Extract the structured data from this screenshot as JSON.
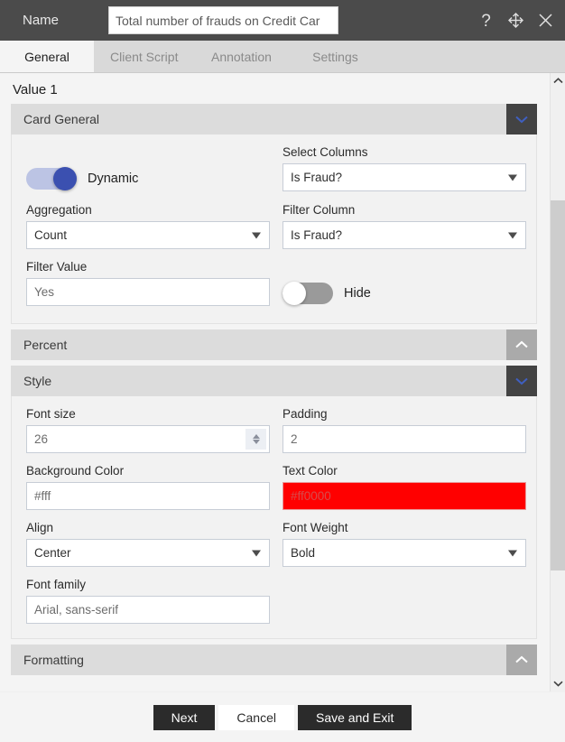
{
  "window": {
    "name_label": "Name",
    "name_value": "Total number of frauds on Credit Car",
    "name_placeholder": "Name",
    "icons": {
      "help": "help-question-icon",
      "move": "move-arrows-icon",
      "close": "close-x-icon"
    }
  },
  "tabs": [
    {
      "label": "General",
      "active": true
    },
    {
      "label": "Client Script",
      "active": false
    },
    {
      "label": "Annotation",
      "active": false
    },
    {
      "label": "Settings",
      "active": false
    }
  ],
  "value_section": {
    "title": "Value 1"
  },
  "sections": {
    "card_general": {
      "title": "Card General",
      "expanded": true,
      "fields": {
        "dynamic_toggle": {
          "label": "Dynamic",
          "state": "on"
        },
        "select_columns": {
          "label": "Select Columns",
          "value": "Is Fraud?"
        },
        "aggregation": {
          "label": "Aggregation",
          "value": "Count"
        },
        "filter_column": {
          "label": "Filter Column",
          "value": "Is Fraud?"
        },
        "filter_value": {
          "label": "Filter Value",
          "value": "Yes"
        },
        "hide_toggle": {
          "label": "Hide",
          "state": "off"
        }
      }
    },
    "percent": {
      "title": "Percent",
      "expanded": false
    },
    "style": {
      "title": "Style",
      "expanded": true,
      "fields": {
        "font_size": {
          "label": "Font size",
          "value": "26"
        },
        "padding": {
          "label": "Padding",
          "value": "2"
        },
        "background_color": {
          "label": "Background Color",
          "value": "#fff",
          "swatch": "#ffffff"
        },
        "text_color": {
          "label": "Text Color",
          "value": "#ff0000",
          "swatch": "#ff0000"
        },
        "align": {
          "label": "Align",
          "value": "Center"
        },
        "font_weight": {
          "label": "Font Weight",
          "value": "Bold"
        },
        "font_family": {
          "label": "Font family",
          "value": "Arial, sans-serif"
        }
      }
    },
    "formatting": {
      "title": "Formatting",
      "expanded": false
    }
  },
  "footer": {
    "next": "Next",
    "cancel": "Cancel",
    "save_exit": "Save and Exit"
  },
  "colors": {
    "titlebar": "#4b4b4b",
    "tab_active_bg": "#f4f4f4",
    "accent_toggle": "#3b50b0",
    "accent_chevron": "#3f5fc0",
    "text_color_swatch": "#ff0000"
  }
}
